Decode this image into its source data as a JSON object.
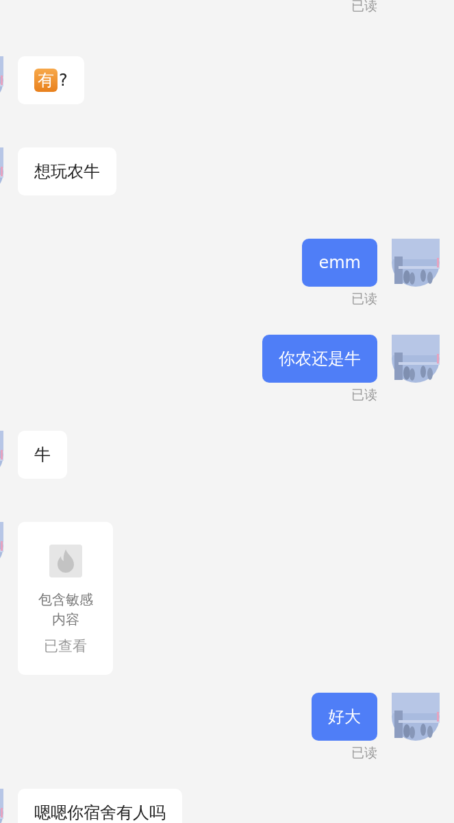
{
  "messages": [
    {
      "kind": "receipt",
      "receipt": "已读"
    },
    {
      "kind": "text",
      "outgoing": false,
      "emoji": "有",
      "text": "?"
    },
    {
      "kind": "text",
      "outgoing": false,
      "text": "想玩农牛"
    },
    {
      "kind": "text",
      "outgoing": true,
      "text": "emm",
      "receipt": "已读"
    },
    {
      "kind": "text",
      "outgoing": true,
      "text": "你农还是牛",
      "receipt": "已读"
    },
    {
      "kind": "text",
      "outgoing": false,
      "text": "牛"
    },
    {
      "kind": "sensitive",
      "outgoing": false,
      "text": "包含敏感内容",
      "status": "已查看"
    },
    {
      "kind": "text",
      "outgoing": true,
      "text": "好大",
      "receipt": "已读"
    },
    {
      "kind": "text",
      "outgoing": false,
      "text": "嗯嗯你宿舍有人吗"
    }
  ]
}
